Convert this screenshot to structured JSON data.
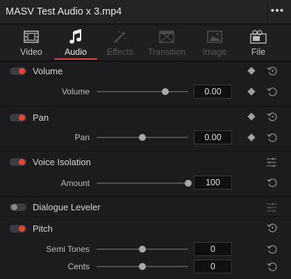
{
  "title": "MASV Test Audio x 3.mp4",
  "menu": {
    "more_icon": "ellipsis-icon",
    "glyph": "•••"
  },
  "tabs": [
    {
      "label": "Video",
      "icon": "film-icon",
      "state": "normal"
    },
    {
      "label": "Audio",
      "icon": "music-note-icon",
      "state": "active"
    },
    {
      "label": "Effects",
      "icon": "magic-wand-icon",
      "state": "disabled"
    },
    {
      "label": "Transition",
      "icon": "transition-icon",
      "state": "disabled"
    },
    {
      "label": "Image",
      "icon": "image-icon",
      "state": "disabled"
    },
    {
      "label": "File",
      "icon": "file-icon",
      "state": "normal"
    }
  ],
  "sections": {
    "volume": {
      "title": "Volume",
      "enabled": true,
      "param": {
        "label": "Volume",
        "value": "0.00",
        "level": 0.75
      }
    },
    "pan": {
      "title": "Pan",
      "enabled": true,
      "param": {
        "label": "Pan",
        "value": "0.00",
        "level": 0.5
      }
    },
    "voice_isolation": {
      "title": "Voice Isolation",
      "enabled": true,
      "param": {
        "label": "Amount",
        "value": "100",
        "level": 1.0
      }
    },
    "dialogue_leveler": {
      "title": "Dialogue Leveler",
      "enabled": false
    },
    "pitch": {
      "title": "Pitch",
      "enabled": true,
      "params": [
        {
          "label": "Semi Tones",
          "value": "0",
          "level": 0.5
        },
        {
          "label": "Cents",
          "value": "0",
          "level": 0.5
        }
      ]
    }
  },
  "colors": {
    "accent": "#e0473c",
    "toggle_on": "#ec4537",
    "background": "#1c1c1e"
  }
}
